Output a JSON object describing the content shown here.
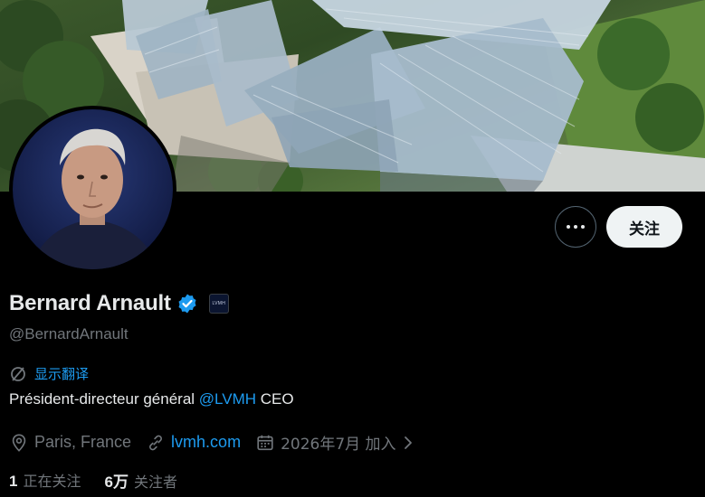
{
  "profile": {
    "display_name": "Bernard Arnault",
    "handle": "@BernardArnault",
    "verified_icon": "verified-badge-icon",
    "affiliate_badge": "LVMH",
    "translate_label": "显示翻译",
    "bio": {
      "text": "Président-directeur général ",
      "mention": "@LVMH",
      "suffix": " CEO"
    },
    "location": "Paris, France",
    "website": "lvmh.com",
    "joined": "2026年7月 加入"
  },
  "actions": {
    "more_icon": "more-dots-icon",
    "follow_label": "关注"
  },
  "stats": {
    "following_count": "1",
    "following_label": "正在关注",
    "followers_count": "6万",
    "followers_label": "关注者"
  },
  "colors": {
    "background": "#000000",
    "accent": "#1d9bf0",
    "text_primary": "#e7e9ea",
    "text_secondary": "#71767b",
    "follow_button_bg": "#eff3f4"
  }
}
